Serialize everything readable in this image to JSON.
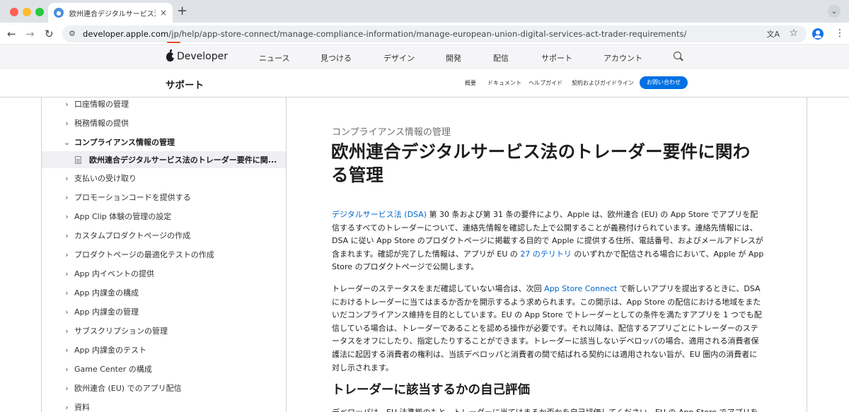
{
  "browser": {
    "tab_title": "欧州連合デジタルサービス法のトレーダー要件に関わる管理",
    "tab_close": "×",
    "new_tab": "+",
    "tab_menu": "⌄",
    "url_host": "developer.apple.com",
    "url_highlight": "/jp",
    "url_path": "/help/app-store-connect/manage-compliance-information/manage-european-union-digital-services-act-trader-requirements/",
    "back": "←",
    "forward": "→",
    "reload": "↻",
    "star": "☆",
    "translate": "文A",
    "kebab": "⋮",
    "site_info": "⚙"
  },
  "globalnav": {
    "logo_text": "Developer",
    "items": [
      "ニュース",
      "見つける",
      "デザイン",
      "開発",
      "配信",
      "サポート",
      "アカウント"
    ]
  },
  "localnav": {
    "title": "サポート",
    "items": [
      "概要",
      "ドキュメント",
      "ヘルプガイド",
      "契約およびガイドライン"
    ],
    "contact": "お問い合わせ"
  },
  "sidebar": {
    "items": [
      {
        "label": "口座情報の管理",
        "chevron": "›"
      },
      {
        "label": "税務情報の提供",
        "chevron": "›"
      },
      {
        "label": "コンプライアンス情報の管理",
        "chevron": "⌄"
      },
      {
        "label": "欧州連合デジタルサービス法のトレーダー要件に関..."
      },
      {
        "label": "支払いの受け取り",
        "chevron": "›"
      },
      {
        "label": "プロモーションコードを提供する",
        "chevron": "›"
      },
      {
        "label": "App Clip 体験の管理の設定",
        "chevron": "›"
      },
      {
        "label": "カスタムプロダクトページの作成",
        "chevron": "›"
      },
      {
        "label": "プロダクトページの最適化テストの作成",
        "chevron": "›"
      },
      {
        "label": "App 内イベントの提供",
        "chevron": "›"
      },
      {
        "label": "App 内課金の構成",
        "chevron": "›"
      },
      {
        "label": "App 内課金の管理",
        "chevron": "›"
      },
      {
        "label": "サブスクリプションの管理",
        "chevron": "›"
      },
      {
        "label": "App 内課金のテスト",
        "chevron": "›"
      },
      {
        "label": "Game Center の構成",
        "chevron": "›"
      },
      {
        "label": "欧州連合 (EU) でのアプリ配信",
        "chevron": "›"
      },
      {
        "label": "資料",
        "chevron": "›"
      }
    ]
  },
  "main": {
    "eyebrow": "コンプライアンス情報の管理",
    "title": "欧州連合デジタルサービス法のトレーダー要件に関わる管理",
    "p1": {
      "link1": "デジタルサービス法 (DSA)",
      "text1": " 第 30 条および第 31 条の要件により、Apple は、欧州連合 (EU) の App Store でアプリを配信するすべてのトレーダーについて、連絡先情報を確認した上で公開することが義務付けられています。連絡先情報には、DSA に従い App Store のプロダクトページに掲載する目的で Apple に提供する住所、電話番号、およびメールアドレスが含まれます。確認が完了した情報は、アプリが EU の ",
      "link2": "27 のテリトリ",
      "text2": " のいずれかで配信される場合において、Apple が App Store のプロダクトページで公開します。"
    },
    "p2": {
      "text1": "トレーダーのステータスをまだ確認していない場合は、次回 ",
      "link1": "App Store Connect",
      "text2": " で新しいアプリを提出するときに、DSA におけるトレーダーに当てはまるか否かを開示するよう求められます。この開示は、App Store の配信における地域をまたいだコンプライアンス維持を目的としています。EU の App Store でトレーダーとしての条件を満たすアプリを 1 つでも配信している場合は、トレーダーであることを認める操作が必要です。それ以降は、配信するアプリごとにトレーダーのステータスをオフにしたり、指定したりすることができます。トレーダーに該当しないデベロッパの場合、適用される消費者保護法に起因する消費者の権利は、当該デベロッパと消費者の間で結ばれる契約には適用されない旨が、EU 圏内の消費者に対し示されます。"
    },
    "section_heading": "トレーダーに該当するかの自己評価",
    "p3": "デベロッパは、EU 法準拠のもと、トレーダーに当てはまるか否かを自己評価してください。EU の App Store でアプリを配信して"
  }
}
